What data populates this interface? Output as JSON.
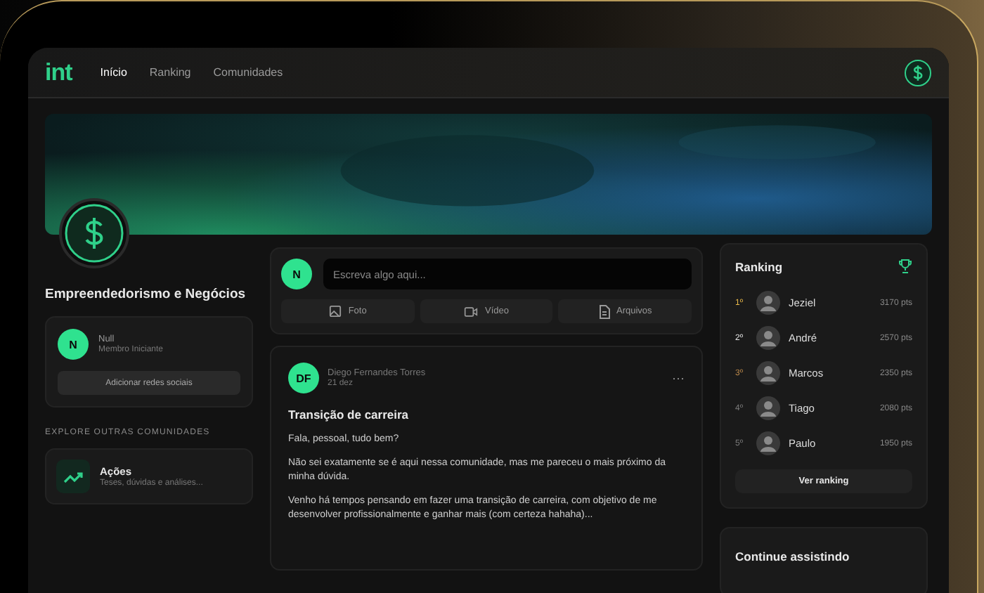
{
  "nav": {
    "logo": "int",
    "links": [
      {
        "label": "Início",
        "selected": true
      },
      {
        "label": "Ranking",
        "selected": false
      },
      {
        "label": "Comunidades",
        "selected": false
      }
    ]
  },
  "community": {
    "title": "Empreendedorismo e Negócios",
    "member": {
      "initial": "N",
      "name": "Null",
      "role": "Membro Iniciante"
    },
    "social_button": "Adicionar redes sociais"
  },
  "explore": {
    "heading": "EXPLORE OUTRAS COMUNIDADES",
    "items": [
      {
        "title": "Ações",
        "subtitle": "Teses, dúvidas e análises..."
      }
    ]
  },
  "composer": {
    "initial": "N",
    "placeholder": "Escreva algo aqui...",
    "actions": [
      {
        "label": "Foto"
      },
      {
        "kind": "video",
        "label": "Vídeo"
      },
      {
        "kind": "file",
        "label": "Arquivos"
      }
    ]
  },
  "post": {
    "initials": "DF",
    "author": "Diego Fernandes Torres",
    "date": "21 dez",
    "menu": "···",
    "title": "Transição de carreira",
    "paragraphs": [
      "Fala, pessoal, tudo bem?",
      "Não sei exatamente se é aqui nessa comunidade, mas me pareceu o mais próximo da minha dúvida.",
      "Venho há tempos pensando em fazer uma transição de carreira, com objetivo de me desenvolver profissionalmente e ganhar mais (com certeza hahaha)..."
    ]
  },
  "ranking": {
    "title": "Ranking",
    "rows": [
      {
        "rank": "1º",
        "color": "#e8b84a",
        "name": "Jeziel",
        "points": "3170 pts"
      },
      {
        "rank": "2º",
        "color": "#e6e6e6",
        "name": "André",
        "points": "2570 pts"
      },
      {
        "rank": "3º",
        "color": "#b8864a",
        "name": "Marcos",
        "points": "2350 pts"
      },
      {
        "rank": "4º",
        "color": "#7a7a7a",
        "name": "Tiago",
        "points": "2080 pts"
      },
      {
        "rank": "5º",
        "color": "#7a7a7a",
        "name": "Paulo",
        "points": "1950 pts"
      }
    ],
    "button": "Ver ranking"
  },
  "continue": {
    "title": "Continue assistindo"
  }
}
